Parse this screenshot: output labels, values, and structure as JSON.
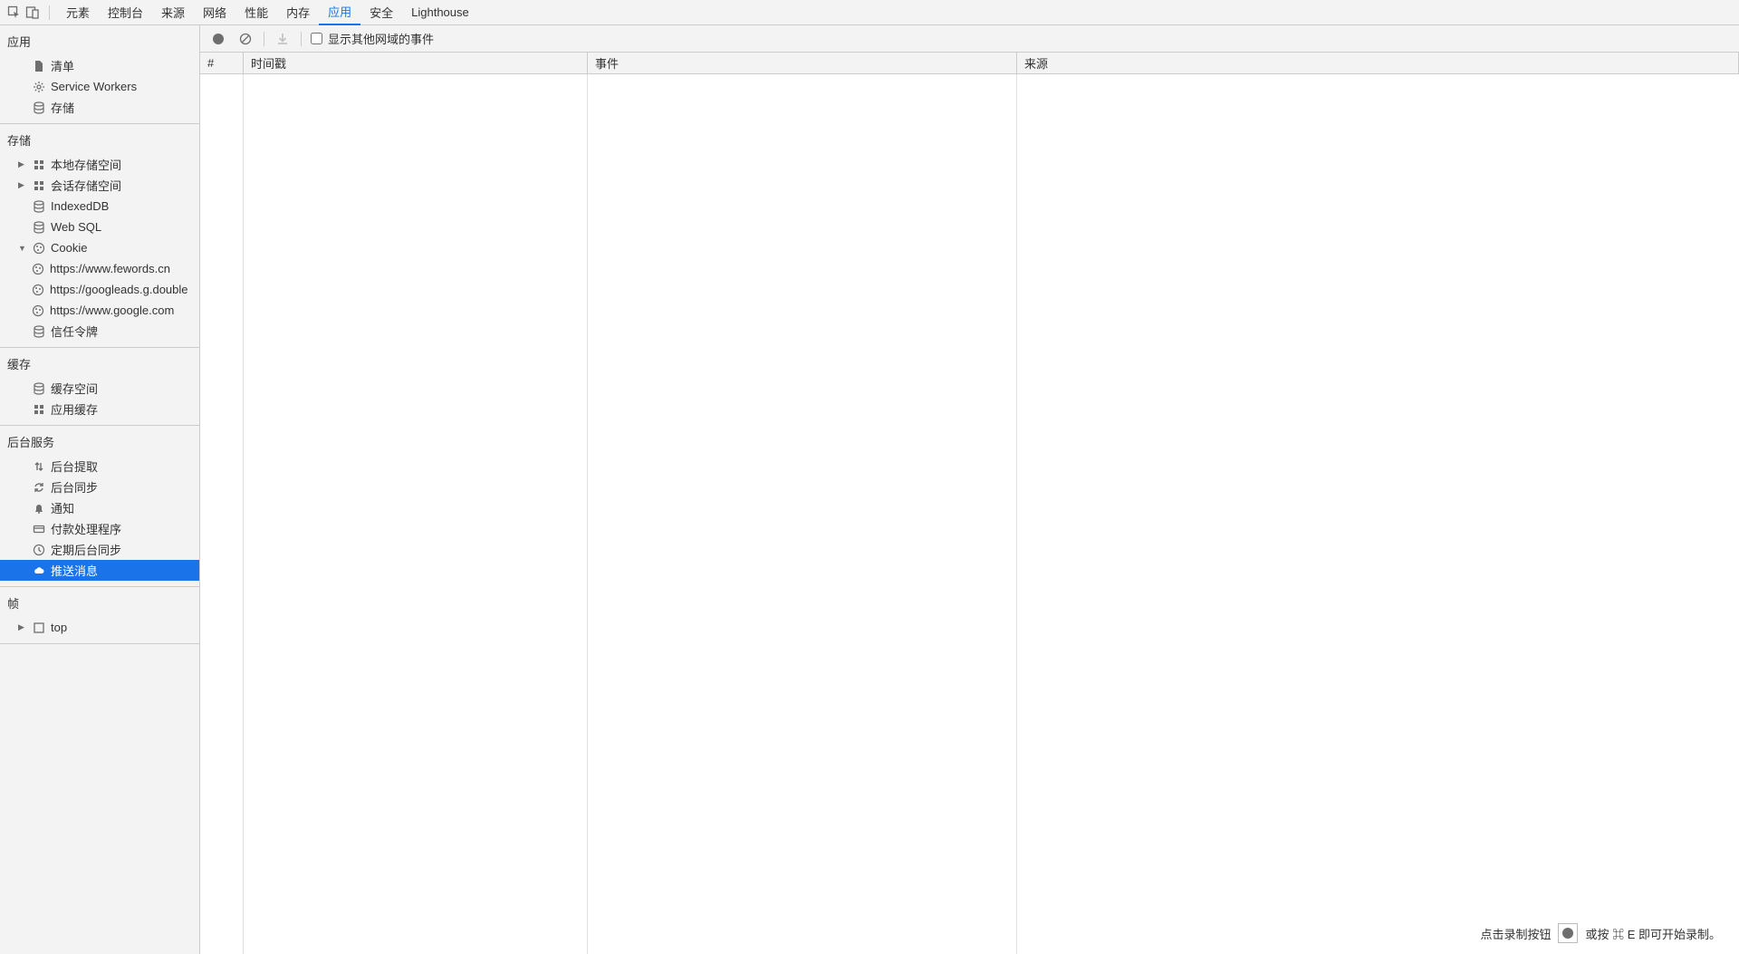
{
  "top_tabs": {
    "items": [
      "元素",
      "控制台",
      "来源",
      "网络",
      "性能",
      "内存",
      "应用",
      "安全",
      "Lighthouse"
    ],
    "active_index": 6
  },
  "sidebar": {
    "sections": {
      "app": {
        "title": "应用",
        "items": [
          {
            "label": "清单",
            "icon": "file"
          },
          {
            "label": "Service Workers",
            "icon": "gear"
          },
          {
            "label": "存储",
            "icon": "db"
          }
        ]
      },
      "storage": {
        "title": "存储",
        "items": [
          {
            "label": "本地存储空间",
            "icon": "grid",
            "expandable": true,
            "expanded": false
          },
          {
            "label": "会话存储空间",
            "icon": "grid",
            "expandable": true,
            "expanded": false
          },
          {
            "label": "IndexedDB",
            "icon": "db"
          },
          {
            "label": "Web SQL",
            "icon": "db"
          },
          {
            "label": "Cookie",
            "icon": "cookie",
            "expandable": true,
            "expanded": true,
            "children": [
              {
                "label": "https://www.fewords.cn",
                "icon": "cookie"
              },
              {
                "label": "https://googleads.g.double",
                "icon": "cookie"
              },
              {
                "label": "https://www.google.com",
                "icon": "cookie"
              }
            ]
          },
          {
            "label": "信任令牌",
            "icon": "db"
          }
        ]
      },
      "cache": {
        "title": "缓存",
        "items": [
          {
            "label": "缓存空间",
            "icon": "db"
          },
          {
            "label": "应用缓存",
            "icon": "grid"
          }
        ]
      },
      "bg": {
        "title": "后台服务",
        "items": [
          {
            "label": "后台提取",
            "icon": "updown"
          },
          {
            "label": "后台同步",
            "icon": "sync"
          },
          {
            "label": "通知",
            "icon": "bell"
          },
          {
            "label": "付款处理程序",
            "icon": "card"
          },
          {
            "label": "定期后台同步",
            "icon": "clock"
          },
          {
            "label": "推送消息",
            "icon": "cloud",
            "selected": true
          }
        ]
      },
      "frames": {
        "title": "帧",
        "items": [
          {
            "label": "top",
            "icon": "frame",
            "expandable": true,
            "expanded": false
          }
        ]
      }
    }
  },
  "toolbar": {
    "checkbox_label": "显示其他网域的事件",
    "checkbox_checked": false
  },
  "table": {
    "columns": [
      "#",
      "时间戳",
      "事件",
      "来源"
    ]
  },
  "footer_hint": {
    "before": "点击录制按钮",
    "after": "或按 ⌘ E 即可开始录制。"
  }
}
